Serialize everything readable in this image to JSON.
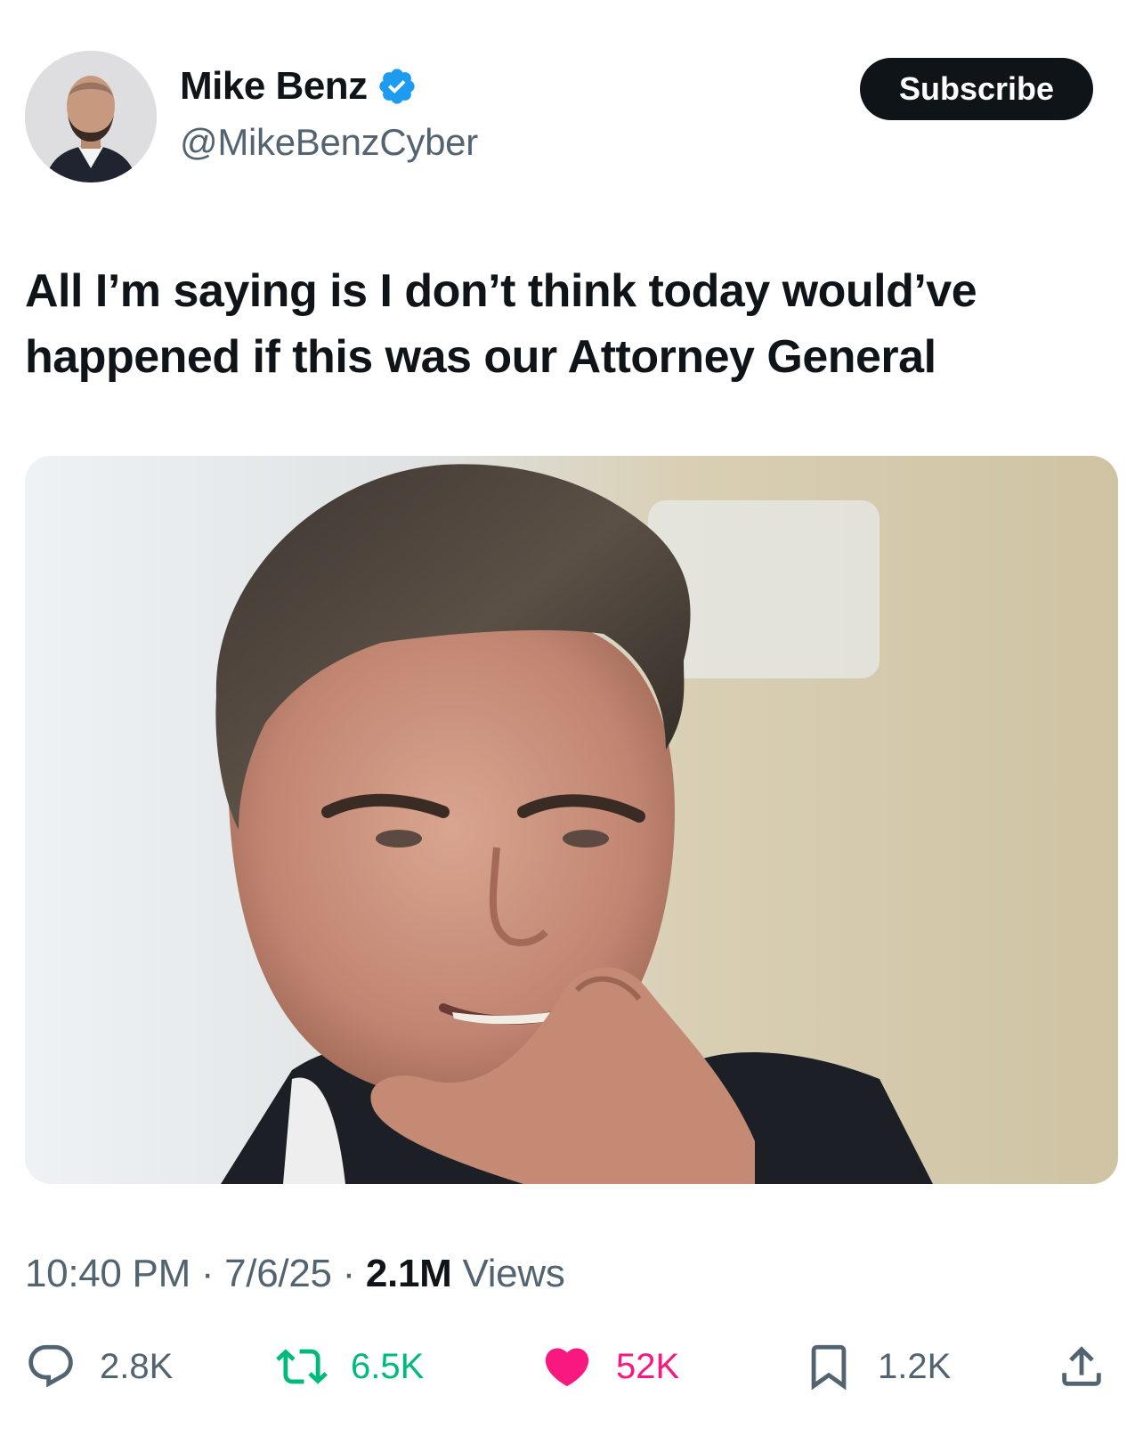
{
  "author": {
    "display_name": "Mike Benz",
    "handle": "@MikeBenzCyber",
    "verified_icon": "verified-badge-icon",
    "verified_color": "#1d9bf0"
  },
  "subscribe_label": "Subscribe",
  "tweet": {
    "text": "All I’m saying is I don’t think today would’ve happened if this was our Attorney General"
  },
  "meta": {
    "time": "10:40 PM",
    "sep1": " · ",
    "date": "7/6/25",
    "sep2": " · ",
    "views_count": "2.1M",
    "views_label": " Views"
  },
  "actions": {
    "reply": {
      "icon": "reply-icon",
      "count": "2.8K"
    },
    "repost": {
      "icon": "repost-icon",
      "count": "6.5K",
      "color": "#00ba7c"
    },
    "like": {
      "icon": "heart-icon",
      "count": "52K",
      "color": "#f91880"
    },
    "bookmark": {
      "icon": "bookmark-icon",
      "count": "1.2K"
    },
    "share": {
      "icon": "share-icon"
    }
  }
}
